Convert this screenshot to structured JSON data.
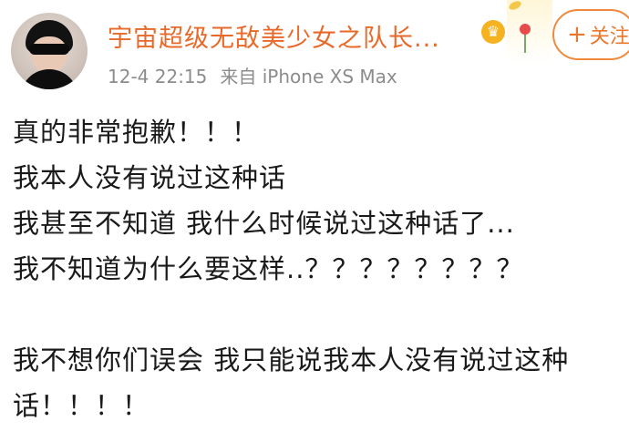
{
  "post": {
    "username": "宇宙超级无敌美少女之队长...",
    "follow_label": "关注",
    "follow_plus": "+",
    "timestamp": "12-4 22:15",
    "source": "来自 iPhone XS Max",
    "lines": [
      "真的非常抱歉！！！",
      "我本人没有说过这种话",
      "我甚至不知道 我什么时候说过这种话了...",
      "我不知道为什么要这样..？？？？？？？？",
      "我不想你们误会 我只能说我本人没有说过这种",
      "话！！！！"
    ]
  },
  "colors": {
    "username": "#e86a2a",
    "follow_border": "#ef8a3c",
    "meta": "#8c8c8c",
    "text": "#1a1a1a"
  },
  "icons": {
    "avatar": "user-avatar",
    "vip": "crown-badge-icon",
    "decoration": "flower-decoration-icon"
  }
}
